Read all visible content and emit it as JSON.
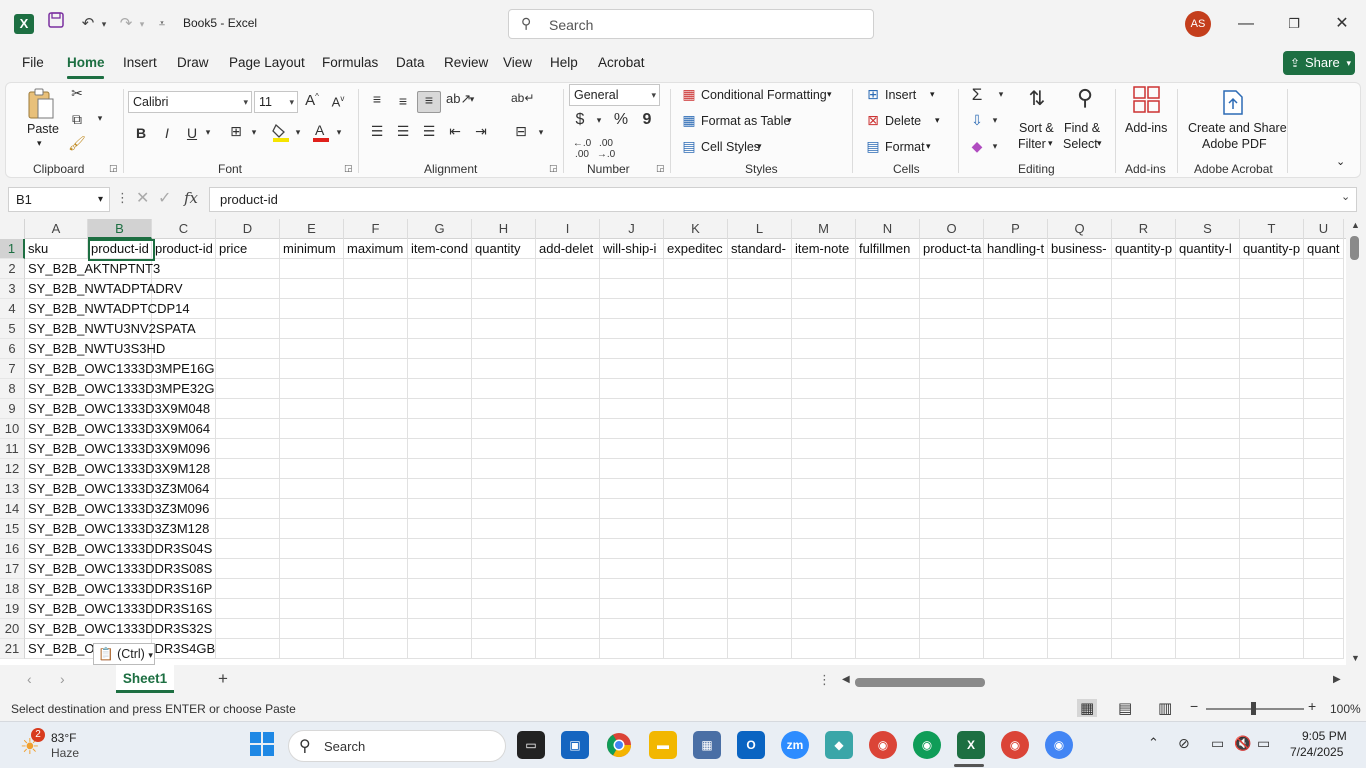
{
  "window": {
    "title": "Book5  -  Excel",
    "search_placeholder": "Search",
    "user_initials": "AS"
  },
  "menu": {
    "tabs": [
      "File",
      "Home",
      "Insert",
      "Draw",
      "Page Layout",
      "Formulas",
      "Data",
      "Review",
      "View",
      "Help",
      "Acrobat"
    ],
    "active": "Home",
    "share_label": "Share"
  },
  "ribbon": {
    "clipboard": {
      "paste_label": "Paste",
      "group_label": "Clipboard"
    },
    "font": {
      "font_name": "Calibri",
      "font_size": "11",
      "bold": "B",
      "italic": "I",
      "underline": "U",
      "group_label": "Font"
    },
    "alignment": {
      "group_label": "Alignment"
    },
    "number": {
      "format": "General",
      "currency": "$",
      "percent": "%",
      "comma": "9",
      "group_label": "Number"
    },
    "styles": {
      "conditional": "Conditional Formatting",
      "format_table": "Format as Table",
      "cell_styles": "Cell Styles",
      "group_label": "Styles"
    },
    "cells": {
      "insert": "Insert",
      "delete": "Delete",
      "format": "Format",
      "group_label": "Cells"
    },
    "editing": {
      "sort_filter_1": "Sort &",
      "sort_filter_2": "Filter",
      "find_select_1": "Find &",
      "find_select_2": "Select",
      "group_label": "Editing"
    },
    "addins": {
      "label": "Add-ins",
      "group_label": "Add-ins"
    },
    "acrobat": {
      "label_1": "Create and Share",
      "label_2": "Adobe PDF",
      "group_label": "Adobe Acrobat"
    }
  },
  "formula_bar": {
    "name_box": "B1",
    "fx": "fx",
    "formula": "product-id"
  },
  "grid": {
    "columns": [
      "A",
      "B",
      "C",
      "D",
      "E",
      "F",
      "G",
      "H",
      "I",
      "J",
      "K",
      "L",
      "M",
      "N",
      "O",
      "P",
      "Q",
      "R",
      "S",
      "T",
      "U"
    ],
    "selected_column": "B",
    "header_row": [
      "sku",
      "product-id",
      "product-id",
      "price",
      "minimum",
      "maximum",
      "item-cond",
      "quantity",
      "add-delet",
      "will-ship-i",
      "expeditec",
      "standard-",
      "item-note",
      "fulfillmen",
      "product-ta",
      "handling-t",
      "business-",
      "quantity-p",
      "quantity-l",
      "quantity-p",
      "quant"
    ],
    "column_a": [
      "SY_B2B_AKTNPTNT3",
      "SY_B2B_NWTADPTADRV",
      "SY_B2B_NWTADPTCDP14",
      "SY_B2B_NWTU3NV2SPATA",
      "SY_B2B_NWTU3S3HD",
      "SY_B2B_OWC1333D3MPE16G",
      "SY_B2B_OWC1333D3MPE32G",
      "SY_B2B_OWC1333D3X9M048",
      "SY_B2B_OWC1333D3X9M064",
      "SY_B2B_OWC1333D3X9M096",
      "SY_B2B_OWC1333D3X9M128",
      "SY_B2B_OWC1333D3Z3M064",
      "SY_B2B_OWC1333D3Z3M096",
      "SY_B2B_OWC1333D3Z3M128",
      "SY_B2B_OWC1333DDR3S04S",
      "SY_B2B_OWC1333DDR3S08S",
      "SY_B2B_OWC1333DDR3S16P",
      "SY_B2B_OWC1333DDR3S16S",
      "SY_B2B_OWC1333DDR3S32S",
      "SY_B2B_OWC1333DDR3S4GB"
    ],
    "paste_tag": "(Ctrl)"
  },
  "sheets": {
    "tabs": [
      "Sheet1"
    ],
    "active": "Sheet1"
  },
  "status": {
    "message": "Select destination and press ENTER or choose Paste",
    "zoom": "100%"
  },
  "taskbar": {
    "weather_temp": "83°F",
    "weather_desc": "Haze",
    "weather_badge": "2",
    "search_label": "Search",
    "time": "9:05 PM",
    "date": "7/24/2025"
  },
  "colors": {
    "excel_green": "#1d6f42",
    "avatar": "#c43e1c"
  }
}
